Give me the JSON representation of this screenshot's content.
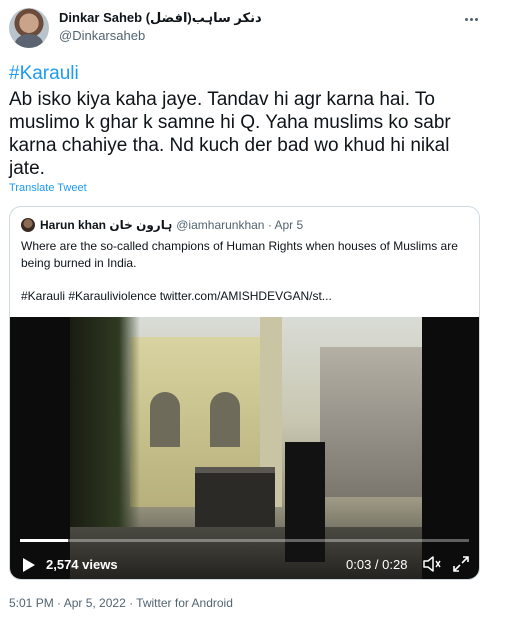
{
  "author": {
    "display_name": "Dinkar Saheb (افضل)دنکر ساہب",
    "handle": "@Dinkarsaheb"
  },
  "tweet": {
    "hashtag": "#Karauli",
    "text": "Ab isko kiya kaha jaye. Tandav hi agr karna hai. To muslimo k ghar k samne hi Q. Yaha muslims ko sabr karna chahiye tha. Nd kuch der bad wo khud hi nikal jate.",
    "translate_label": "Translate Tweet",
    "timestamp": "5:01 PM · Apr 5, 2022 · Twitter for Android"
  },
  "quoted": {
    "name": "Harun khan ہارون خان",
    "meta": "@iamharunkhan · Apr 5",
    "text": "Where are the so-called champions of Human Rights when houses of Muslims are being burned in India.",
    "tags": "#Karauli #Karauliviolence  twitter.com/AMISHDEVGAN/st..."
  },
  "video": {
    "views": "2,574 views",
    "time": "0:03 / 0:28",
    "progress_fraction": 0.107
  },
  "colors": {
    "link": "#1d9bf0",
    "secondary_text": "#536471",
    "border": "#cfd9de"
  }
}
